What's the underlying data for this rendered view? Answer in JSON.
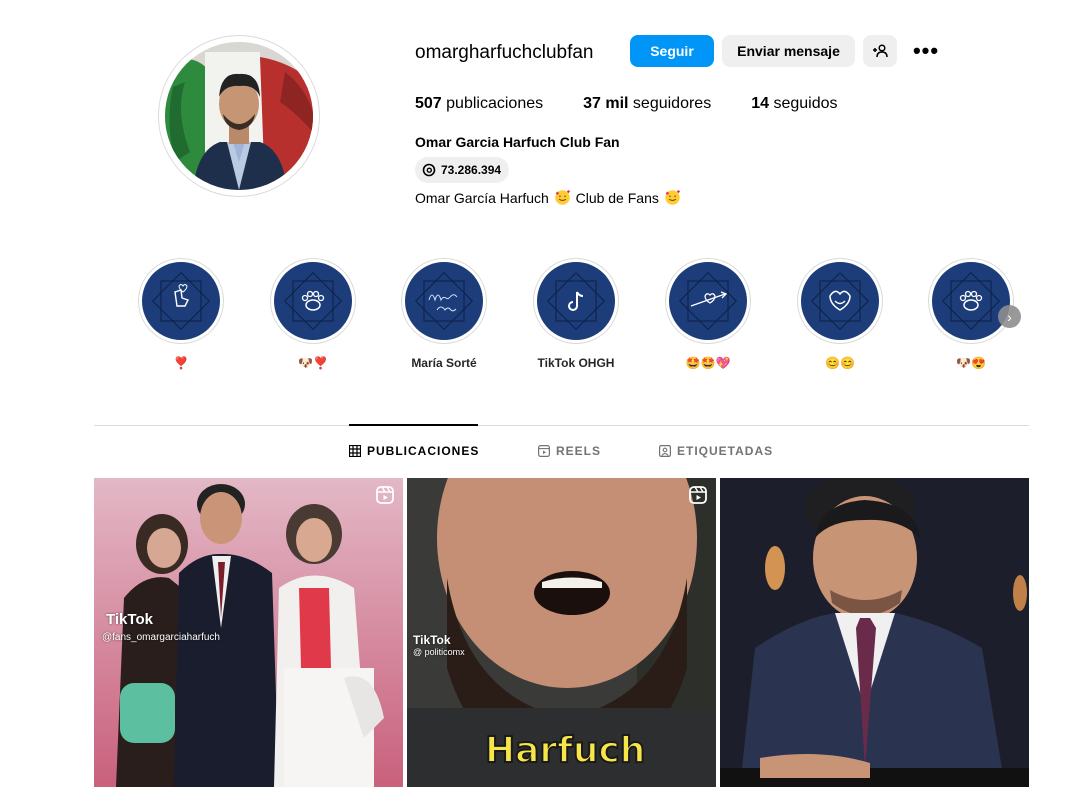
{
  "profile": {
    "username": "omargharfuchclubfan",
    "follow_label": "Seguir",
    "message_label": "Enviar mensaje",
    "suggest_icon": "add-person-icon",
    "more_label": "•••",
    "stats": {
      "posts_count": "507",
      "posts_label": "publicaciones",
      "followers_count": "37 mil",
      "followers_label": "seguidores",
      "following_count": "14",
      "following_label": "seguidos"
    },
    "full_name": "Omar Garcia Harfuch Club Fan",
    "threads_handle": "73.286.394",
    "bio_part1": "Omar García Harfuch ",
    "bio_part2": " Club de Fans "
  },
  "highlights": [
    {
      "label": "❣️",
      "icon": "heart-hand-icon"
    },
    {
      "label": "🐶❣️",
      "icon": "paw-icon"
    },
    {
      "label": "María Sorté",
      "icon": "signature-icon"
    },
    {
      "label": "TikTok OHGH",
      "icon": "tiktok-icon"
    },
    {
      "label": "🤩🤩💖",
      "icon": "arrow-heart-icon"
    },
    {
      "label": "😊😊",
      "icon": "smile-heart-icon"
    },
    {
      "label": "🐶😍",
      "icon": "paw-icon"
    }
  ],
  "tabs": {
    "posts": "PUBLICACIONES",
    "reels": "REELS",
    "tagged": "ETIQUETADAS"
  },
  "posts": [
    {
      "tiktok_logo": "TikTok",
      "tiktok_handle": "@fans_omargarciaharfuch",
      "is_reel": true
    },
    {
      "tiktok_logo": "TikTok",
      "tiktok_handle": "@ politicomx",
      "caption": "Harfuch",
      "is_reel": true
    },
    {
      "is_reel": false
    }
  ],
  "colors": {
    "primary_button": "#0095f6",
    "secondary_button": "#efefef",
    "highlight_navy": "#1c3d7a"
  }
}
